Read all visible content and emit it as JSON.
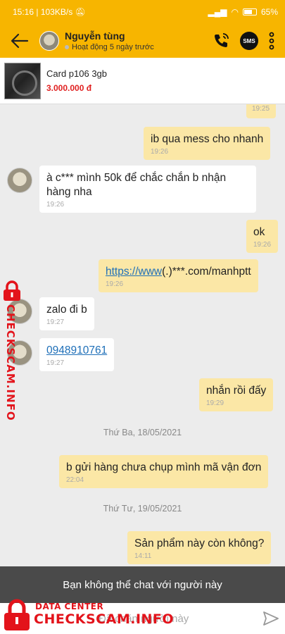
{
  "status_bar": {
    "time": "15:16",
    "network_speed": "103KB/s",
    "battery": "65"
  },
  "header": {
    "contact_name": "Nguyễn tùng",
    "contact_status": "Hoạt động 5 ngày trước",
    "sms_label": "SMS"
  },
  "product": {
    "name": "Card p106 3gb",
    "price": "3.000.000 đ"
  },
  "messages": [
    {
      "side": "me",
      "text": "",
      "time": "19:25"
    },
    {
      "side": "me",
      "text": "ib qua mess cho nhanh",
      "time": "19:26"
    },
    {
      "side": "them",
      "text": "à c*** mình 50k để chắc chắn b nhận hàng nha",
      "time": "19:26"
    },
    {
      "side": "me",
      "text": "ok",
      "time": "19:26"
    },
    {
      "side": "me",
      "link_text": "https://www",
      "text_after": "(.)***.com/manhptt",
      "time": "19:26"
    },
    {
      "side": "them",
      "text": "zalo đi b",
      "time": "19:27"
    },
    {
      "side": "them",
      "link_text": "0948910761",
      "time": "19:27"
    },
    {
      "side": "me",
      "text": "nhắn rồi đấy",
      "time": "19:29"
    },
    {
      "side": "me",
      "text": "b gửi hàng chưa chụp mình mã vận đơn",
      "time": "22:04"
    },
    {
      "side": "me",
      "text": "Sản phẩm này còn không?",
      "time": "14:11"
    }
  ],
  "date_separators": [
    "Thứ Ba, 18/05/2021",
    "Thứ Tư, 19/05/2021"
  ],
  "blocked_notice": "Bạn không thể chat với người này",
  "input": {
    "placeholder": "Đã chặn người này"
  },
  "watermark": {
    "line1": "DATA CENTER",
    "line2": "CHECKSCAM.INFO",
    "side_text": "CHECKSCAM.INFO"
  },
  "colors": {
    "accent": "#f7b500",
    "my_bubble": "#fbe7a6",
    "watermark_red": "#e3131b",
    "price": "#e02020"
  },
  "icons": [
    "back-arrow-icon",
    "phone-call-icon",
    "sms-icon",
    "more-vertical-icon",
    "send-icon",
    "lock-icon"
  ]
}
